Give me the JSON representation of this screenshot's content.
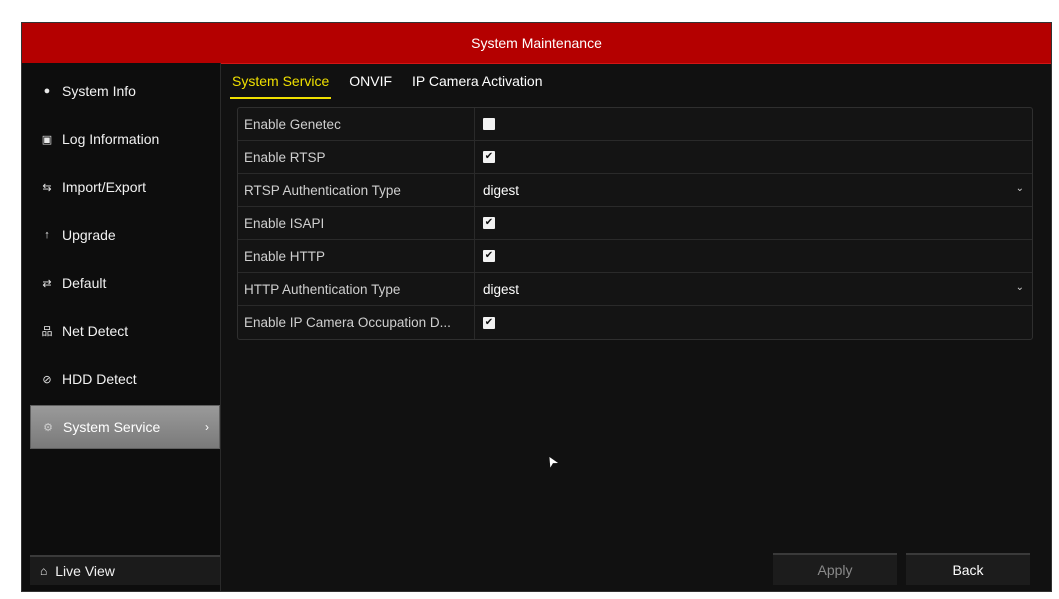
{
  "window": {
    "title": "System Maintenance"
  },
  "sidebar": {
    "items": [
      {
        "label": "System Info",
        "icon": "exclamation-circle-icon",
        "glyph": "●"
      },
      {
        "label": "Log Information",
        "icon": "log-document-icon",
        "glyph": "▣"
      },
      {
        "label": "Import/Export",
        "icon": "import-export-icon",
        "glyph": "⇆"
      },
      {
        "label": "Upgrade",
        "icon": "upgrade-arrow-icon",
        "glyph": "↑"
      },
      {
        "label": "Default",
        "icon": "default-reset-icon",
        "glyph": "⇄"
      },
      {
        "label": "Net Detect",
        "icon": "network-icon",
        "glyph": "品"
      },
      {
        "label": "HDD Detect",
        "icon": "hdd-detect-icon",
        "glyph": "⊘"
      },
      {
        "label": "System Service",
        "icon": "gear-icon",
        "glyph": "⚙",
        "chevron": "›"
      }
    ],
    "live_view": {
      "label": "Live View",
      "icon": "home-icon",
      "glyph": "⌂"
    }
  },
  "tabs": [
    {
      "label": "System Service"
    },
    {
      "label": "ONVIF"
    },
    {
      "label": "IP Camera Activation"
    }
  ],
  "settings": [
    {
      "label": "Enable Genetec",
      "type": "checkbox",
      "checked": false
    },
    {
      "label": "Enable RTSP",
      "type": "checkbox",
      "checked": true
    },
    {
      "label": "RTSP Authentication Type",
      "type": "select",
      "value": "digest"
    },
    {
      "label": "Enable ISAPI",
      "type": "checkbox",
      "checked": true
    },
    {
      "label": "Enable HTTP",
      "type": "checkbox",
      "checked": true
    },
    {
      "label": "HTTP Authentication Type",
      "type": "select",
      "value": "digest"
    },
    {
      "label": "Enable IP Camera Occupation D...",
      "type": "checkbox",
      "checked": true
    }
  ],
  "glyphs": {
    "check": "✔",
    "dropdown": "⌄",
    "cursor": "➤"
  },
  "buttons": {
    "apply": "Apply",
    "back": "Back"
  },
  "colors": {
    "title_bar": "#b40000",
    "active_tab": "#f0e000",
    "background": "#111111"
  }
}
